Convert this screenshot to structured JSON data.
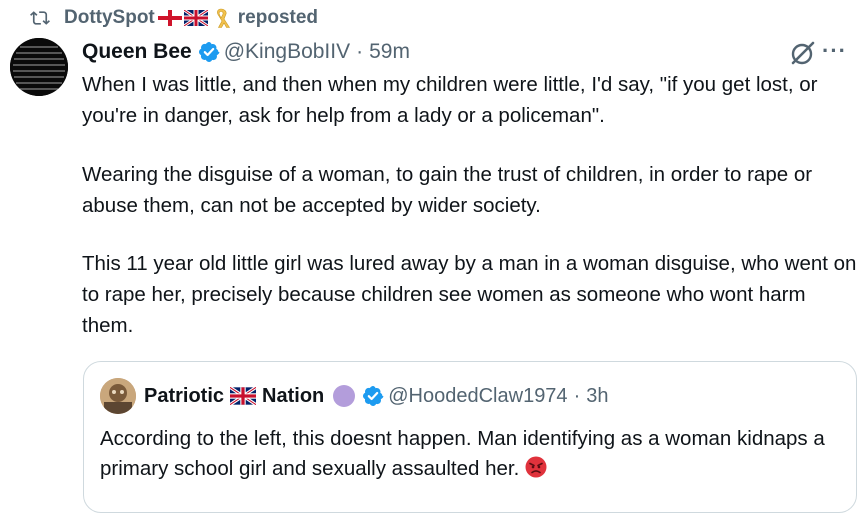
{
  "repost": {
    "user": "DottySpot",
    "label": "reposted",
    "icons": [
      "repost-icon",
      "england-flag",
      "uk-flag",
      "yellow-ribbon"
    ]
  },
  "tweet": {
    "display_name": "Queen Bee",
    "handle": "@KingBobIIV",
    "separator": "·",
    "time": "59m",
    "paragraphs": [
      "When I was little, and then when my children were little, I'd say, \"if you get lost, or you're in danger, ask for help from a lady or a policeman\".",
      "Wearing the disguise of a woman, to gain the trust of children, in order to rape or abuse them, can not be accepted by wider society.",
      "This 11 year old little girl was lured away by a man in a woman disguise, who went on to rape her, precisely because children see women as someone who wont harm them."
    ],
    "icons": [
      "verified-badge-icon",
      "grok-icon",
      "more-icon"
    ]
  },
  "quote": {
    "name_part1": "Patriotic",
    "name_part2": "Nation",
    "handle": "@HoodedClaw1974",
    "separator": "·",
    "time": "3h",
    "text": "According to the left, this doesnt happen. Man identifying as a woman kidnaps a primary school girl and sexually assaulted her.",
    "icons": [
      "uk-flag",
      "purple-circle",
      "verified-badge-icon",
      "angry-face-emoji"
    ]
  },
  "colors": {
    "text": "#0f1419",
    "secondary": "#536471",
    "verified": "#1d9bf0",
    "border": "#cfd9de"
  }
}
